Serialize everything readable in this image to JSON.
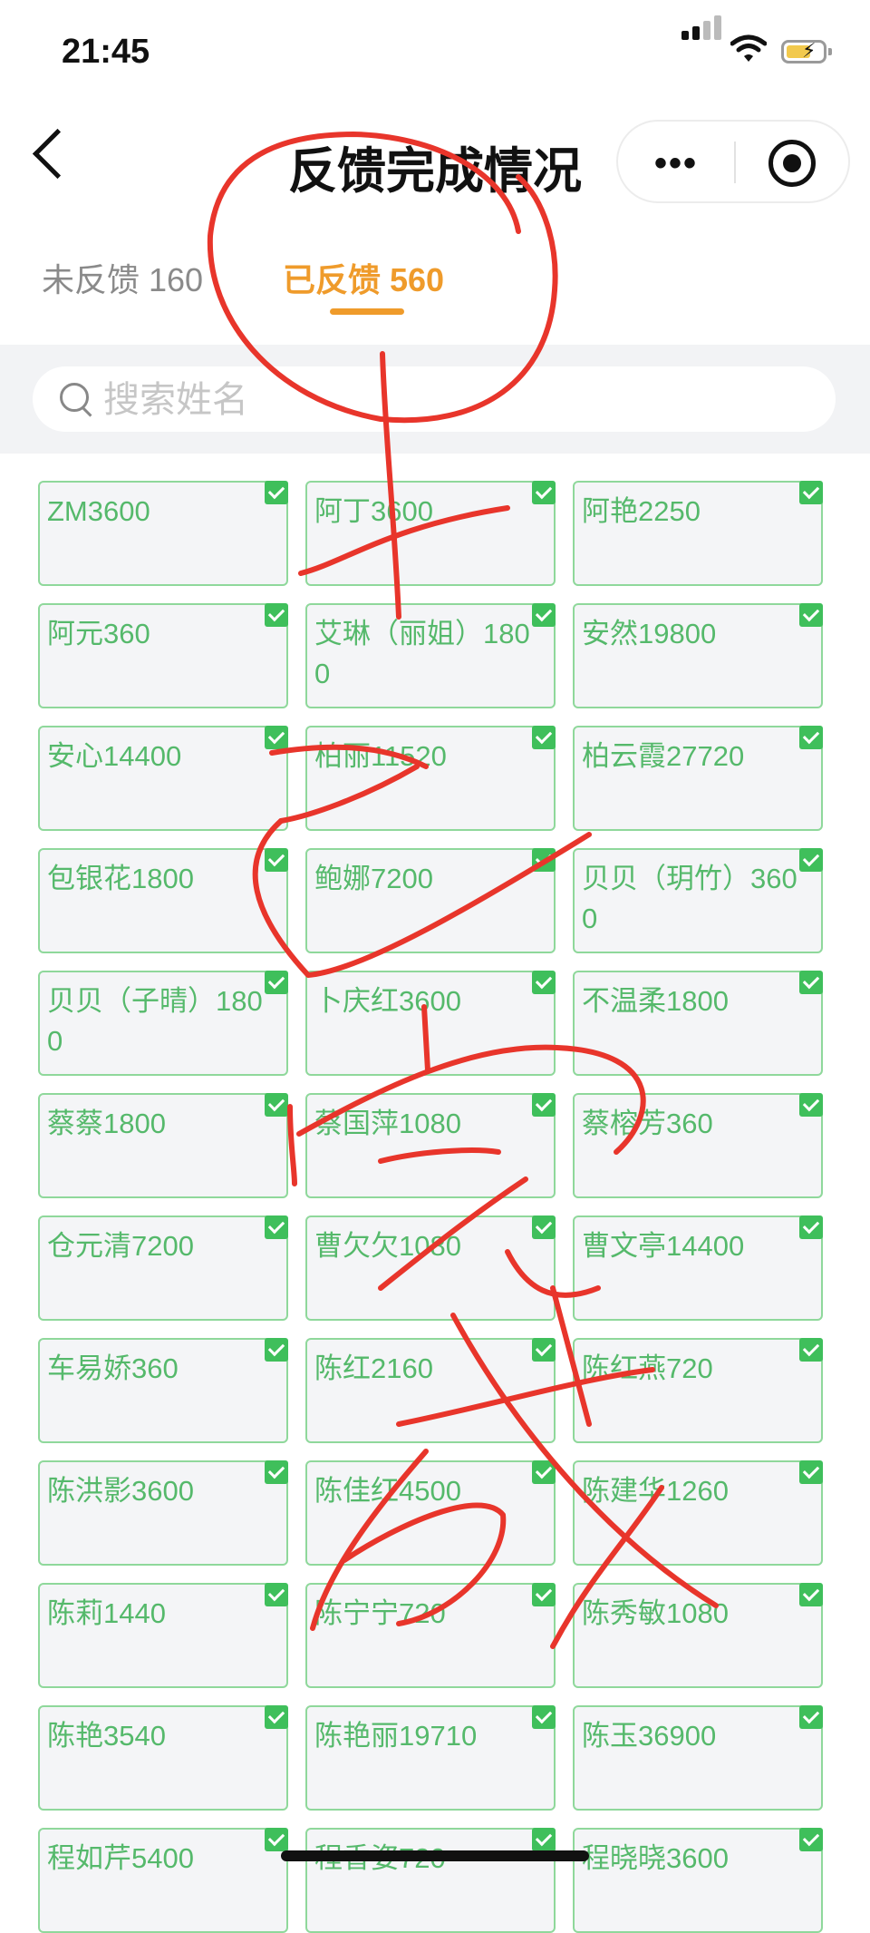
{
  "status_bar": {
    "time": "21:45"
  },
  "nav": {
    "title": "反馈完成情况"
  },
  "tabs": [
    {
      "label": "未反馈 160",
      "selected": false
    },
    {
      "label": "已反馈 560",
      "selected": true
    }
  ],
  "search": {
    "placeholder": "搜索姓名"
  },
  "colors": {
    "accent": "#ef9b2b",
    "card_text": "#55b96b",
    "check": "#3fbf5b",
    "card_border": "#8fd89b",
    "annotation": "#e8352b"
  },
  "list": [
    "ZM3600",
    "阿丁3600",
    "阿艳2250",
    "阿元360",
    "艾琳（丽姐）1800",
    "安然19800",
    "安心14400",
    "柏丽11520",
    "柏云霞27720",
    "包银花1800",
    "鲍娜7200",
    "贝贝（玥竹）3600",
    "贝贝（子晴）1800",
    "卜庆红3600",
    "不温柔1800",
    "蔡蔡1800",
    "蔡国萍1080",
    "蔡榕芳360",
    "仓元清7200",
    "曹欠欠1080",
    "曹文亭14400",
    "车易娇360",
    "陈红2160",
    "陈红燕720",
    "陈洪影3600",
    "陈佳红4500",
    "陈建华1260",
    "陈莉1440",
    "陈宁宁720",
    "陈秀敏1080",
    "陈艳3540",
    "陈艳丽19710",
    "陈玉36900",
    "程如芹5400",
    "程香姿720",
    "程晓晓3600"
  ]
}
